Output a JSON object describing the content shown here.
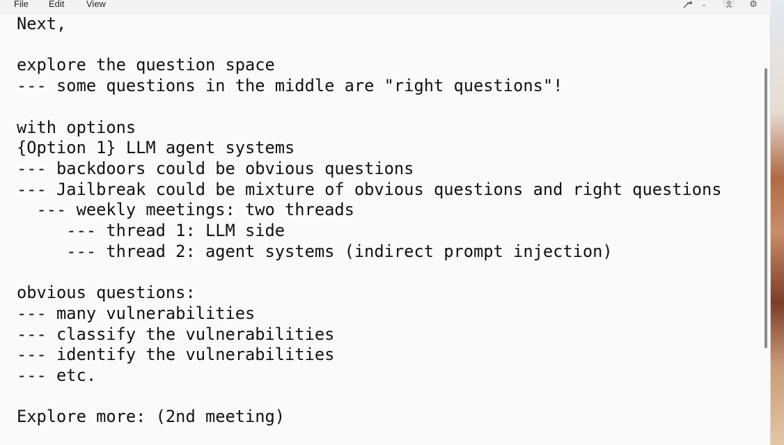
{
  "menu": {
    "file": "File",
    "edit": "Edit",
    "view": "View"
  },
  "toolbar": {
    "icons": [
      "copilot-icon",
      "chevron-down-icon",
      "account-icon",
      "settings-icon"
    ]
  },
  "document": {
    "lines": [
      "Next,",
      "",
      "explore the question space",
      "--- some questions in the middle are \"right questions\"!",
      "",
      "with options",
      "{Option 1} LLM agent systems",
      "--- backdoors could be obvious questions",
      "--- Jailbreak could be mixture of obvious questions and right questions",
      "  --- weekly meetings: two threads",
      "     --- thread 1: LLM side",
      "     --- thread 2: agent systems (indirect prompt injection)",
      "",
      "obvious questions:",
      "--- many vulnerabilities",
      "--- classify the vulnerabilities",
      "--- identify the vulnerabilities",
      "--- etc.",
      "",
      "Explore more: (2nd meeting)"
    ]
  }
}
